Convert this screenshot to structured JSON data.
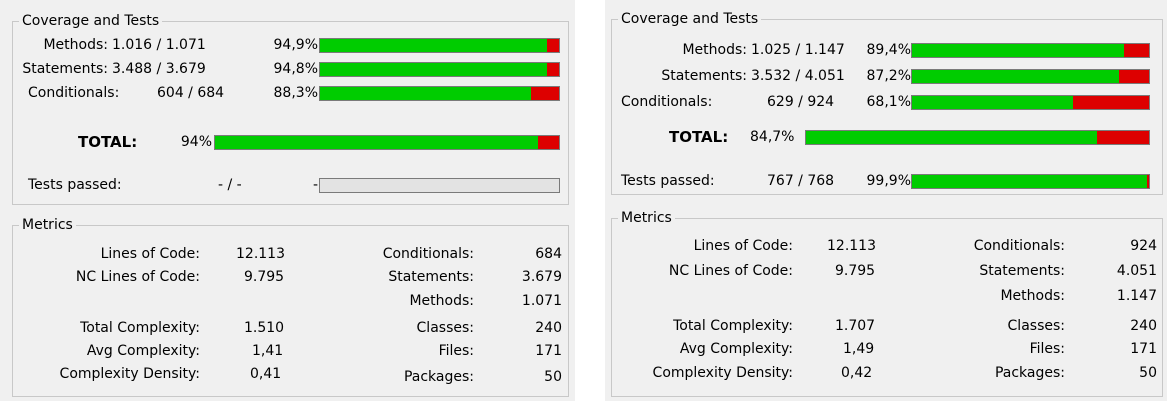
{
  "left": {
    "coverage_title": "Coverage and Tests",
    "rows": [
      {
        "label": "Methods:",
        "value": "1.016 / 1.071",
        "pct": "94,9%",
        "fraction": 0.949
      },
      {
        "label": "Statements:",
        "value": "3.488 / 3.679",
        "pct": "94,8%",
        "fraction": 0.948
      },
      {
        "label": "Conditionals:",
        "value": "604 / 684",
        "pct": "88,3%",
        "fraction": 0.883
      }
    ],
    "total": {
      "label": "TOTAL:",
      "pct": "94%",
      "fraction": 0.94
    },
    "tests": {
      "label": "Tests passed:",
      "value": "- / -",
      "pct": "-"
    },
    "metrics_title": "Metrics",
    "metrics": {
      "loc_label": "Lines of Code:",
      "loc": "12.113",
      "ncloc_label": "NC Lines of Code:",
      "ncloc": "9.795",
      "total_complexity_label": "Total Complexity:",
      "total_complexity": "1.510",
      "avg_complexity_label": "Avg Complexity:",
      "avg_complexity": "1,41",
      "density_label": "Complexity Density:",
      "density": "0,41",
      "conditionals_label": "Conditionals:",
      "conditionals": "684",
      "statements_label": "Statements:",
      "statements": "3.679",
      "methods_label": "Methods:",
      "methods": "1.071",
      "classes_label": "Classes:",
      "classes": "240",
      "files_label": "Files:",
      "files": "171",
      "packages_label": "Packages:",
      "packages": "50"
    }
  },
  "right": {
    "coverage_title": "Coverage and Tests",
    "rows": [
      {
        "label": "Methods:",
        "value": "1.025 / 1.147",
        "pct": "89,4%",
        "fraction": 0.894
      },
      {
        "label": "Statements:",
        "value": "3.532 / 4.051",
        "pct": "87,2%",
        "fraction": 0.872
      },
      {
        "label": "Conditionals:",
        "value": "629 / 924",
        "pct": "68,1%",
        "fraction": 0.681
      }
    ],
    "total": {
      "label": "TOTAL:",
      "pct": "84,7%",
      "fraction": 0.847
    },
    "tests": {
      "label": "Tests passed:",
      "value": "767 / 768",
      "pct": "99,9%",
      "fraction": 0.99
    },
    "metrics_title": "Metrics",
    "metrics": {
      "loc_label": "Lines of Code:",
      "loc": "12.113",
      "ncloc_label": "NC Lines of Code:",
      "ncloc": "9.795",
      "total_complexity_label": "Total Complexity:",
      "total_complexity": "1.707",
      "avg_complexity_label": "Avg Complexity:",
      "avg_complexity": "1,49",
      "density_label": "Complexity Density:",
      "density": "0,42",
      "conditionals_label": "Conditionals:",
      "conditionals": "924",
      "statements_label": "Statements:",
      "statements": "4.051",
      "methods_label": "Methods:",
      "methods": "1.147",
      "classes_label": "Classes:",
      "classes": "240",
      "files_label": "Files:",
      "files": "171",
      "packages_label": "Packages:",
      "packages": "50"
    }
  },
  "colors": {
    "covered": "#00cc00",
    "uncovered": "#dd0000",
    "empty_bar": "#e3e3e3",
    "panel_bg": "#f0f0f0"
  }
}
